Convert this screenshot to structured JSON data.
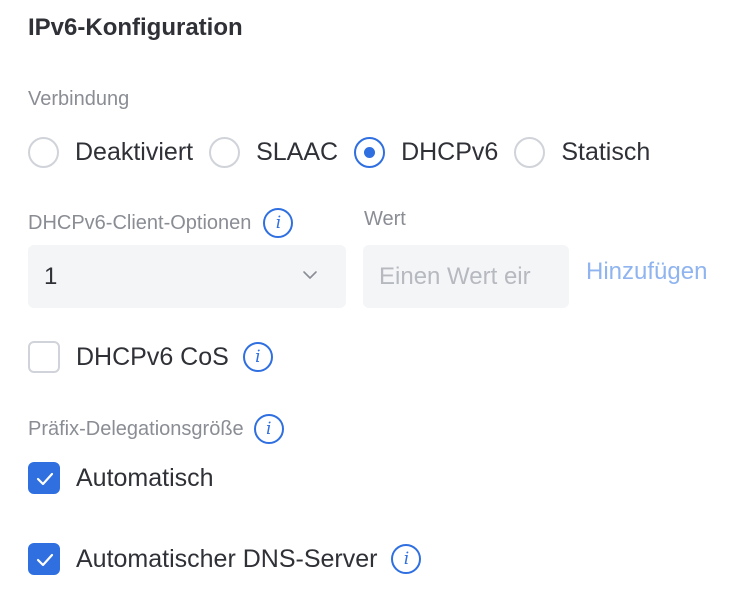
{
  "title": "IPv6-Konfiguration",
  "connection": {
    "label": "Verbindung",
    "options": [
      {
        "label": "Deaktiviert",
        "checked": false
      },
      {
        "label": "SLAAC",
        "checked": false
      },
      {
        "label": "DHCPv6",
        "checked": true
      },
      {
        "label": "Statisch",
        "checked": false
      }
    ]
  },
  "client_options": {
    "label": "DHCPv6-Client-Optionen",
    "select_value": "1",
    "value_label": "Wert",
    "value_placeholder": "Einen Wert eir",
    "add_label": "Hinzufügen"
  },
  "cos": {
    "label": "DHCPv6 CoS",
    "checked": false
  },
  "prefix": {
    "label": "Präfix-Delegationsgröße",
    "auto_label": "Automatisch",
    "auto_checked": true
  },
  "dns": {
    "label": "Automatischer DNS-Server",
    "checked": true
  },
  "colors": {
    "accent": "#2f6fe0",
    "link": "#8fb4ef",
    "label": "#8a8d94"
  }
}
